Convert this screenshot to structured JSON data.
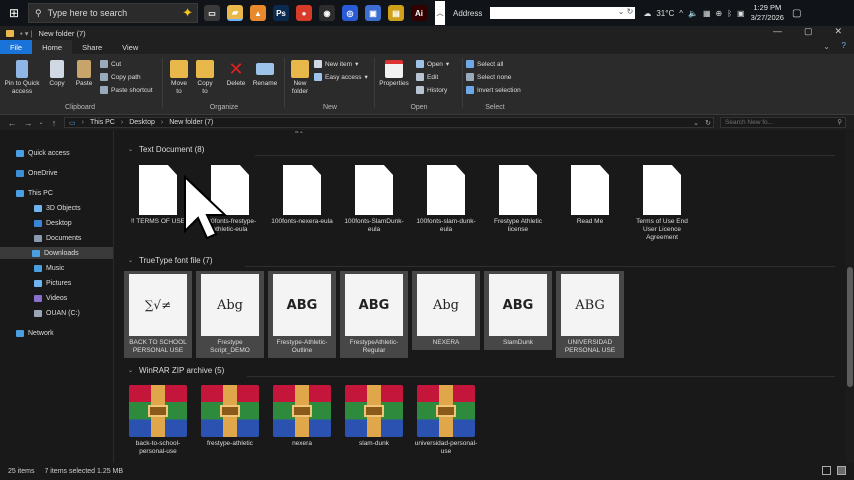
{
  "taskbar": {
    "search_placeholder": "Type here to search",
    "address_label": "Address",
    "weather": "31°C",
    "time": "1:29 PM",
    "date": "3/27/2026",
    "apps": [
      {
        "name": "task-view",
        "color": "#3a3a3a",
        "glyph": "▭"
      },
      {
        "name": "file-explorer",
        "color": "#e8b84a",
        "glyph": "▰"
      },
      {
        "name": "vlc",
        "color": "#e8892b",
        "glyph": "▲"
      },
      {
        "name": "photoshop",
        "color": "#0a2a4f",
        "glyph": "Ps"
      },
      {
        "name": "chrome",
        "color": "#d93b2b",
        "glyph": "●"
      },
      {
        "name": "obs",
        "color": "#2c2c2c",
        "glyph": "◉"
      },
      {
        "name": "app-blue",
        "color": "#2a5bd7",
        "glyph": "◎"
      },
      {
        "name": "app-monitor",
        "color": "#3c6fd1",
        "glyph": "▣"
      },
      {
        "name": "app-yellow",
        "color": "#cfa11a",
        "glyph": "▤"
      },
      {
        "name": "illustrator",
        "color": "#330000",
        "glyph": "Ai"
      }
    ]
  },
  "window": {
    "title": "New folder (7)"
  },
  "ribbon_tabs": [
    "File",
    "Home",
    "Share",
    "View"
  ],
  "ribbon": {
    "clipboard": {
      "label": "Clipboard",
      "pin": "Pin to Quick access",
      "copy": "Copy",
      "paste": "Paste",
      "cut": "Cut",
      "copy_path": "Copy path",
      "paste_shortcut": "Paste shortcut"
    },
    "organize": {
      "label": "Organize",
      "move_to": "Move to",
      "copy_to": "Copy to",
      "delete": "Delete",
      "rename": "Rename"
    },
    "new": {
      "label": "New",
      "new_folder": "New folder",
      "new_item": "New item",
      "easy_access": "Easy access"
    },
    "open": {
      "label": "Open",
      "properties": "Properties",
      "open": "Open",
      "edit": "Edit",
      "history": "History"
    },
    "select": {
      "label": "Select",
      "select_all": "Select all",
      "select_none": "Select none",
      "invert": "Invert selection"
    }
  },
  "navbar": {
    "path": [
      "This PC",
      "Desktop",
      "New folder (7)"
    ],
    "search_placeholder": "Search New fo..."
  },
  "sidebar": [
    {
      "label": "Quick access",
      "icon": "star-icon",
      "color": "#4a9fe0",
      "indent": 0
    },
    {
      "label": "OneDrive",
      "icon": "cloud-icon",
      "color": "#3b8fd9",
      "indent": 0
    },
    {
      "label": "This PC",
      "icon": "computer-icon",
      "color": "#4a9fe0",
      "indent": 0
    },
    {
      "label": "3D Objects",
      "icon": "cube-icon",
      "color": "#6fb3f0",
      "indent": 1
    },
    {
      "label": "Desktop",
      "icon": "desktop-icon",
      "color": "#3a86d6",
      "indent": 1
    },
    {
      "label": "Documents",
      "icon": "documents-icon",
      "color": "#8a9bb0",
      "indent": 1
    },
    {
      "label": "Downloads",
      "icon": "download-icon",
      "color": "#4a9fe0",
      "indent": 1,
      "selected": true
    },
    {
      "label": "Music",
      "icon": "music-icon",
      "color": "#4a9fe0",
      "indent": 1
    },
    {
      "label": "Pictures",
      "icon": "pictures-icon",
      "color": "#6fb3f0",
      "indent": 1
    },
    {
      "label": "Videos",
      "icon": "videos-icon",
      "color": "#8b6fd0",
      "indent": 1
    },
    {
      "label": "OUAN (C:)",
      "icon": "drive-icon",
      "color": "#9aa6b5",
      "indent": 1
    },
    {
      "label": "Network",
      "icon": "network-icon",
      "color": "#4a9fe0",
      "indent": 0
    }
  ],
  "groups": {
    "text": {
      "header": "Text Document (8)",
      "items": [
        "!! TERMS OF USE",
        "100fonts-frestype-athletic-eula",
        "100fonts-nexera-eula",
        "100fonts-SlamDunk-eula",
        "100fonts-slam-dunk-eula",
        "Frestype Athletic license",
        "Read Me",
        "Terms of Use End User Licence Agreement"
      ]
    },
    "font": {
      "header": "TrueType font file (7)",
      "items": [
        {
          "label": "BACK TO SCHOOL PERSONAL USE",
          "preview": "∑√≠"
        },
        {
          "label": "Frestype Script_DEMO",
          "preview": "Abg"
        },
        {
          "label": "Frestype-Athletic-Outline",
          "preview": "ABG"
        },
        {
          "label": "FrestypeAthletic-Regular",
          "preview": "ABG"
        },
        {
          "label": "NEXERA",
          "preview": "Abg"
        },
        {
          "label": "SlamDunk",
          "preview": "ABG"
        },
        {
          "label": "UNIVERSIDAD PERSONAL USE",
          "preview": "ABG"
        }
      ]
    },
    "zip": {
      "header": "WinRAR ZIP archive (5)",
      "items": [
        "back-to-school-personal-use",
        "frestype-athletic",
        "nexera",
        "slam-dunk",
        "universidad-personal-use"
      ]
    }
  },
  "status": {
    "items": "25 items",
    "selected": "7 items selected  1.25 MB"
  }
}
